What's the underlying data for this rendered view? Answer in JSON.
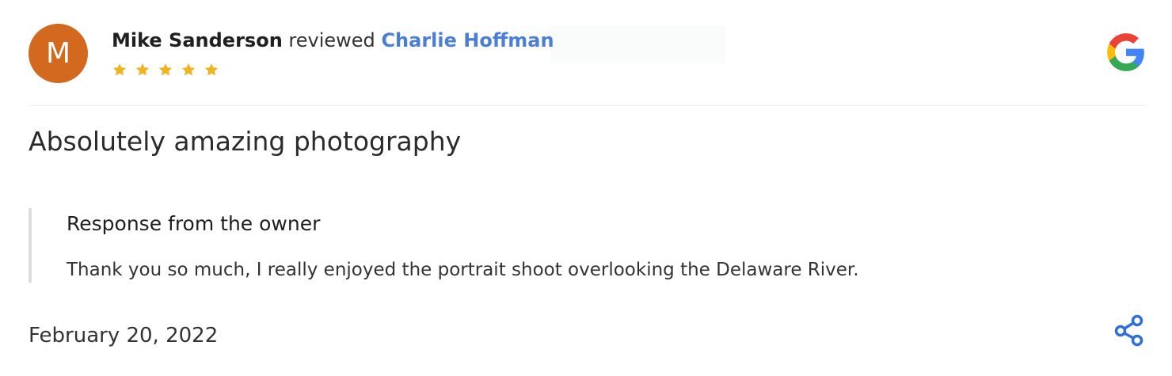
{
  "review": {
    "avatar_initial": "M",
    "reviewer_name": "Mike Sanderson",
    "reviewed_word": "reviewed",
    "business_name": "Charlie Hoffman",
    "rating": 5,
    "rating_max": 5,
    "title": "Absolutely amazing photography",
    "date": "February 20, 2022"
  },
  "owner_response": {
    "heading": "Response from the owner",
    "text": "Thank you so much, I really enjoyed the portrait shoot overlooking the Delaware River."
  },
  "icons": {
    "google_logo": "google-logo",
    "share": "share-icon",
    "star": "star-icon"
  },
  "colors": {
    "avatar_background": "#d2691e",
    "business_link": "#4a7fd4",
    "star": "#f0b41e",
    "share_icon": "#2f6fdc",
    "google_blue": "#4285F4",
    "google_red": "#EA4335",
    "google_yellow": "#FBBC05",
    "google_green": "#34A853"
  }
}
